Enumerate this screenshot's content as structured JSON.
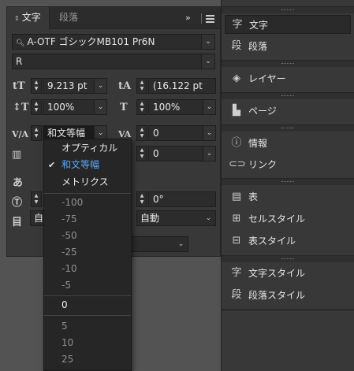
{
  "panel": {
    "tabs": {
      "character": "文字",
      "paragraph": "段落",
      "collapse": "››"
    },
    "font_family": "A-OTF ゴシックMB101 Pr6N",
    "font_style": "R",
    "font_size": "9.213 pt",
    "leading": "(16.122 pt",
    "vertical_scale": "100%",
    "horizontal_scale": "100%",
    "kerning": "和文等幅",
    "tracking": "0",
    "baseline_shift": "0",
    "rotation": "0°",
    "language": "自動",
    "left_partial": "自",
    "icons": {
      "font_size": "tT",
      "leading": "tA",
      "vertical_scale": "↕T",
      "horizontal_scale": "T",
      "kerning": "V/A",
      "tracking": "VA",
      "tsume": "あ",
      "rotation": "T",
      "mojikumi": "目"
    }
  },
  "kerning_menu": {
    "options": [
      "オプティカル",
      "和文等幅",
      "メトリクス"
    ],
    "selected": "和文等幅",
    "numbers_negative": [
      "-100",
      "-75",
      "-50",
      "-25",
      "-10",
      "-5"
    ],
    "zero": "0",
    "numbers_positive": [
      "5",
      "10",
      "25"
    ]
  },
  "dock": {
    "items": [
      {
        "label": "文字",
        "icon": "字"
      },
      {
        "label": "段落",
        "icon": "段"
      },
      {
        "label": "レイヤー",
        "icon": "layers-icon"
      },
      {
        "label": "ページ",
        "icon": "pages-icon"
      },
      {
        "label": "情報",
        "icon": "info-icon"
      },
      {
        "label": "リンク",
        "icon": "link-icon"
      },
      {
        "label": "表",
        "icon": "table-icon"
      },
      {
        "label": "セルスタイル",
        "icon": "cell-style-icon"
      },
      {
        "label": "表スタイル",
        "icon": "table-style-icon"
      },
      {
        "label": "文字スタイル",
        "icon": "char-style-icon"
      },
      {
        "label": "段落スタイル",
        "icon": "para-style-icon"
      }
    ]
  }
}
